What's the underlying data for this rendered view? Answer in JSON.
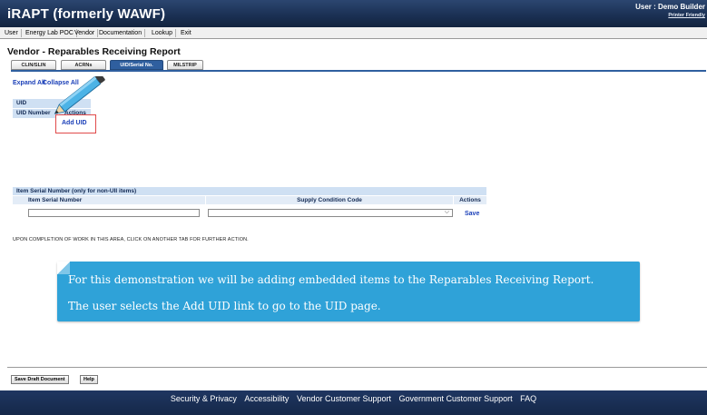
{
  "app": {
    "title": "iRAPT (formerly WAWF)",
    "user_label": "User : Demo Builder",
    "printer_friendly": "Printer Friendly"
  },
  "menu": [
    "User",
    "Energy Lab POC",
    "Vendor",
    "Documentation",
    "Lookup",
    "Exit"
  ],
  "page": {
    "heading": "Vendor - Reparables Receiving Report",
    "tabs": [
      "CLIN/SLIN",
      "ACRNs",
      "UID/Serial No.",
      "MILSTRIP"
    ],
    "active_tab": "UID/Serial No."
  },
  "uid_section": {
    "expand_all": "Expand All",
    "collapse_all": "Collapse All",
    "header": "UID",
    "column_uid_number": "UID Number",
    "column_actions": "Actions",
    "add_uid": "Add UID"
  },
  "serial_section": {
    "title": "Item Serial Number (only for non-UII items)",
    "col_item_serial": "Item Serial Number",
    "col_supply_condition": "Supply Condition Code",
    "col_actions": "Actions",
    "item_serial_value": "",
    "supply_condition_value": "",
    "save": "Save"
  },
  "instruction": "UPON COMPLETION OF WORK IN THIS AREA, CLICK ON ANOTHER TAB FOR FURTHER ACTION.",
  "callout": {
    "line1": "For this demonstration we will be adding embedded items to the Reparables Receiving Report.",
    "line2": "The user selects the Add UID link to go to the UID page."
  },
  "buttons": {
    "save_draft": "Save Draft Document",
    "help": "Help"
  },
  "footer": [
    "Security & Privacy",
    "Accessibility",
    "Vendor Customer Support",
    "Government Customer Support",
    "FAQ"
  ],
  "colors": {
    "header": "#1a2f52",
    "active_tab": "#2f5f9f",
    "callout": "#2fa2d8",
    "highlight_box": "#e04a4a",
    "link": "#1a3fb8"
  }
}
